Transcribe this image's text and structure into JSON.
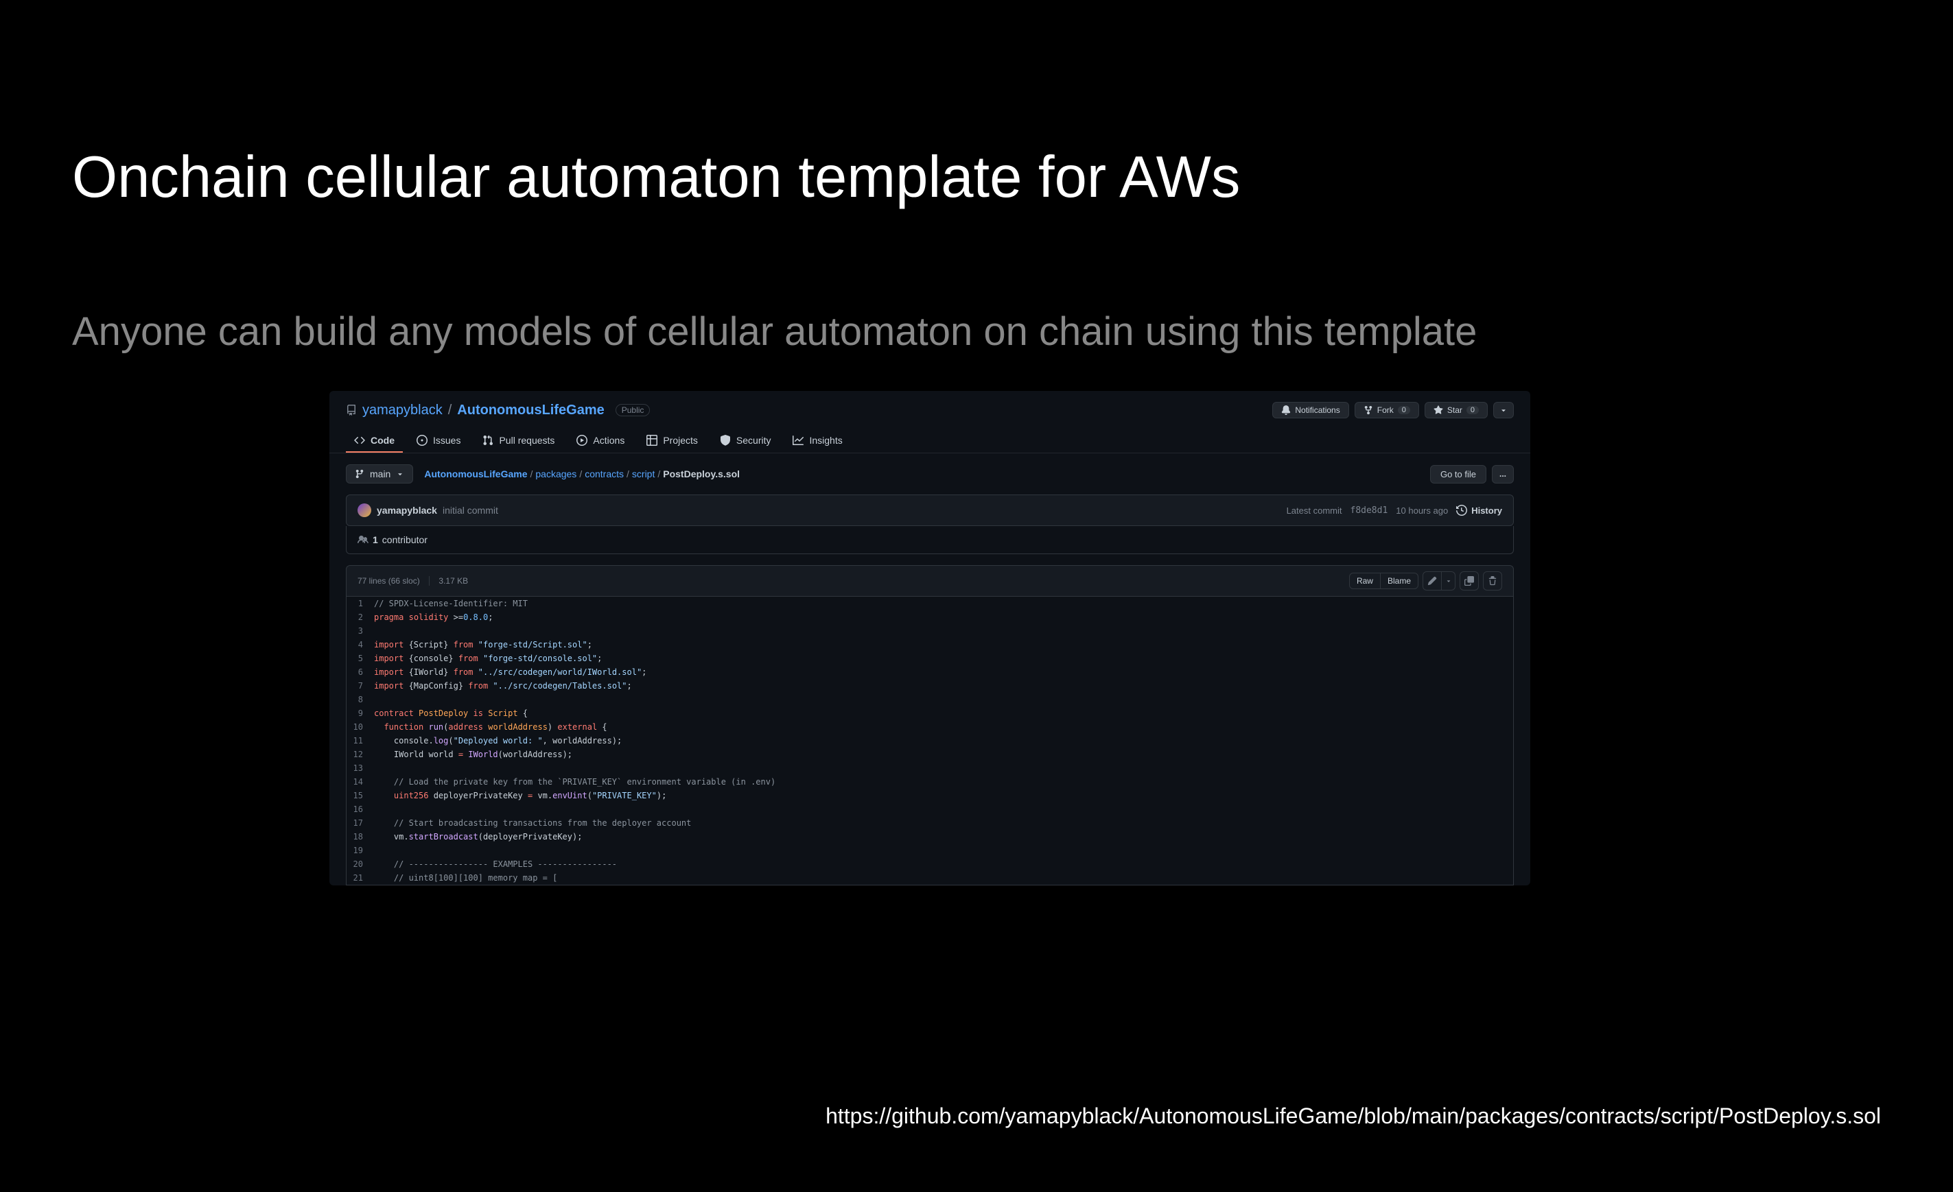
{
  "slide": {
    "title": "Onchain cellular automaton template for AWs",
    "subtitle": "Anyone can build any models of cellular automaton on chain using this template",
    "footer_url": "https://github.com/yamapyblack/AutonomousLifeGame/blob/main/packages/contracts/script/PostDeploy.s.sol"
  },
  "repo": {
    "owner": "yamapyblack",
    "name": "AutonomousLifeGame",
    "visibility": "Public"
  },
  "repo_actions": {
    "notifications": "Notifications",
    "fork": "Fork",
    "fork_count": "0",
    "star": "Star",
    "star_count": "0"
  },
  "nav": {
    "code": "Code",
    "issues": "Issues",
    "pulls": "Pull requests",
    "actions": "Actions",
    "projects": "Projects",
    "security": "Security",
    "insights": "Insights"
  },
  "branch": {
    "label": "main"
  },
  "breadcrumb": {
    "root": "AutonomousLifeGame",
    "p1": "packages",
    "p2": "contracts",
    "p3": "script",
    "file": "PostDeploy.s.sol"
  },
  "file_nav_buttons": {
    "go_to_file": "Go to file",
    "more": "..."
  },
  "commit": {
    "author": "yamapyblack",
    "message": "initial commit",
    "latest_label": "Latest commit",
    "sha": "f8de8d1",
    "time": "10 hours ago",
    "history": "History"
  },
  "contributors": {
    "count": "1",
    "label": "contributor"
  },
  "file_header": {
    "stats": "77 lines (66 sloc)",
    "size": "3.17 KB",
    "raw": "Raw",
    "blame": "Blame"
  },
  "code": {
    "lines": [
      {
        "n": 1,
        "segs": [
          {
            "c": "c-comment",
            "t": "// SPDX-License-Identifier: MIT"
          }
        ]
      },
      {
        "n": 2,
        "segs": [
          {
            "c": "c-keyword",
            "t": "pragma"
          },
          {
            "c": "",
            "t": " "
          },
          {
            "c": "c-keyword",
            "t": "solidity"
          },
          {
            "c": "",
            "t": " >="
          },
          {
            "c": "c-num",
            "t": "0.8.0"
          },
          {
            "c": "",
            "t": ";"
          }
        ]
      },
      {
        "n": 3,
        "segs": []
      },
      {
        "n": 4,
        "segs": [
          {
            "c": "c-keyword",
            "t": "import"
          },
          {
            "c": "",
            "t": " {Script} "
          },
          {
            "c": "c-keyword",
            "t": "from"
          },
          {
            "c": "",
            "t": " "
          },
          {
            "c": "c-string",
            "t": "\"forge-std/Script.sol\""
          },
          {
            "c": "",
            "t": ";"
          }
        ]
      },
      {
        "n": 5,
        "segs": [
          {
            "c": "c-keyword",
            "t": "import"
          },
          {
            "c": "",
            "t": " {console} "
          },
          {
            "c": "c-keyword",
            "t": "from"
          },
          {
            "c": "",
            "t": " "
          },
          {
            "c": "c-string",
            "t": "\"forge-std/console.sol\""
          },
          {
            "c": "",
            "t": ";"
          }
        ]
      },
      {
        "n": 6,
        "segs": [
          {
            "c": "c-keyword",
            "t": "import"
          },
          {
            "c": "",
            "t": " {IWorld} "
          },
          {
            "c": "c-keyword",
            "t": "from"
          },
          {
            "c": "",
            "t": " "
          },
          {
            "c": "c-string",
            "t": "\"../src/codegen/world/IWorld.sol\""
          },
          {
            "c": "",
            "t": ";"
          }
        ]
      },
      {
        "n": 7,
        "segs": [
          {
            "c": "c-keyword",
            "t": "import"
          },
          {
            "c": "",
            "t": " {MapConfig} "
          },
          {
            "c": "c-keyword",
            "t": "from"
          },
          {
            "c": "",
            "t": " "
          },
          {
            "c": "c-string",
            "t": "\"../src/codegen/Tables.sol\""
          },
          {
            "c": "",
            "t": ";"
          }
        ]
      },
      {
        "n": 8,
        "segs": []
      },
      {
        "n": 9,
        "segs": [
          {
            "c": "c-keyword",
            "t": "contract"
          },
          {
            "c": "",
            "t": " "
          },
          {
            "c": "c-type",
            "t": "PostDeploy"
          },
          {
            "c": "",
            "t": " "
          },
          {
            "c": "c-keyword",
            "t": "is"
          },
          {
            "c": "",
            "t": " "
          },
          {
            "c": "c-type",
            "t": "Script"
          },
          {
            "c": "",
            "t": " {"
          }
        ]
      },
      {
        "n": 10,
        "segs": [
          {
            "c": "",
            "t": "  "
          },
          {
            "c": "c-keyword",
            "t": "function"
          },
          {
            "c": "",
            "t": " "
          },
          {
            "c": "c-function",
            "t": "run"
          },
          {
            "c": "",
            "t": "("
          },
          {
            "c": "c-keyword",
            "t": "address"
          },
          {
            "c": "",
            "t": " "
          },
          {
            "c": "c-type",
            "t": "worldAddress"
          },
          {
            "c": "",
            "t": ") "
          },
          {
            "c": "c-keyword",
            "t": "external"
          },
          {
            "c": "",
            "t": " {"
          }
        ]
      },
      {
        "n": 11,
        "segs": [
          {
            "c": "",
            "t": "    console."
          },
          {
            "c": "c-function",
            "t": "log"
          },
          {
            "c": "",
            "t": "("
          },
          {
            "c": "c-string",
            "t": "\"Deployed world: \""
          },
          {
            "c": "",
            "t": ", worldAddress);"
          }
        ]
      },
      {
        "n": 12,
        "segs": [
          {
            "c": "",
            "t": "    IWorld world "
          },
          {
            "c": "c-keyword",
            "t": "="
          },
          {
            "c": "",
            "t": " "
          },
          {
            "c": "c-function",
            "t": "IWorld"
          },
          {
            "c": "",
            "t": "(worldAddress);"
          }
        ]
      },
      {
        "n": 13,
        "segs": []
      },
      {
        "n": 14,
        "segs": [
          {
            "c": "",
            "t": "    "
          },
          {
            "c": "c-comment",
            "t": "// Load the private key from the `PRIVATE_KEY` environment variable (in .env)"
          }
        ]
      },
      {
        "n": 15,
        "segs": [
          {
            "c": "",
            "t": "    "
          },
          {
            "c": "c-keyword",
            "t": "uint256"
          },
          {
            "c": "",
            "t": " deployerPrivateKey "
          },
          {
            "c": "c-keyword",
            "t": "="
          },
          {
            "c": "",
            "t": " vm."
          },
          {
            "c": "c-function",
            "t": "envUint"
          },
          {
            "c": "",
            "t": "("
          },
          {
            "c": "c-string",
            "t": "\"PRIVATE_KEY\""
          },
          {
            "c": "",
            "t": ");"
          }
        ]
      },
      {
        "n": 16,
        "segs": []
      },
      {
        "n": 17,
        "segs": [
          {
            "c": "",
            "t": "    "
          },
          {
            "c": "c-comment",
            "t": "// Start broadcasting transactions from the deployer account"
          }
        ]
      },
      {
        "n": 18,
        "segs": [
          {
            "c": "",
            "t": "    vm."
          },
          {
            "c": "c-function",
            "t": "startBroadcast"
          },
          {
            "c": "",
            "t": "(deployerPrivateKey);"
          }
        ]
      },
      {
        "n": 19,
        "segs": []
      },
      {
        "n": 20,
        "segs": [
          {
            "c": "",
            "t": "    "
          },
          {
            "c": "c-comment",
            "t": "// ---------------- EXAMPLES ----------------"
          }
        ]
      },
      {
        "n": 21,
        "segs": [
          {
            "c": "",
            "t": "    "
          },
          {
            "c": "c-comment",
            "t": "// uint8[100][100] memory map = ["
          }
        ]
      }
    ]
  }
}
